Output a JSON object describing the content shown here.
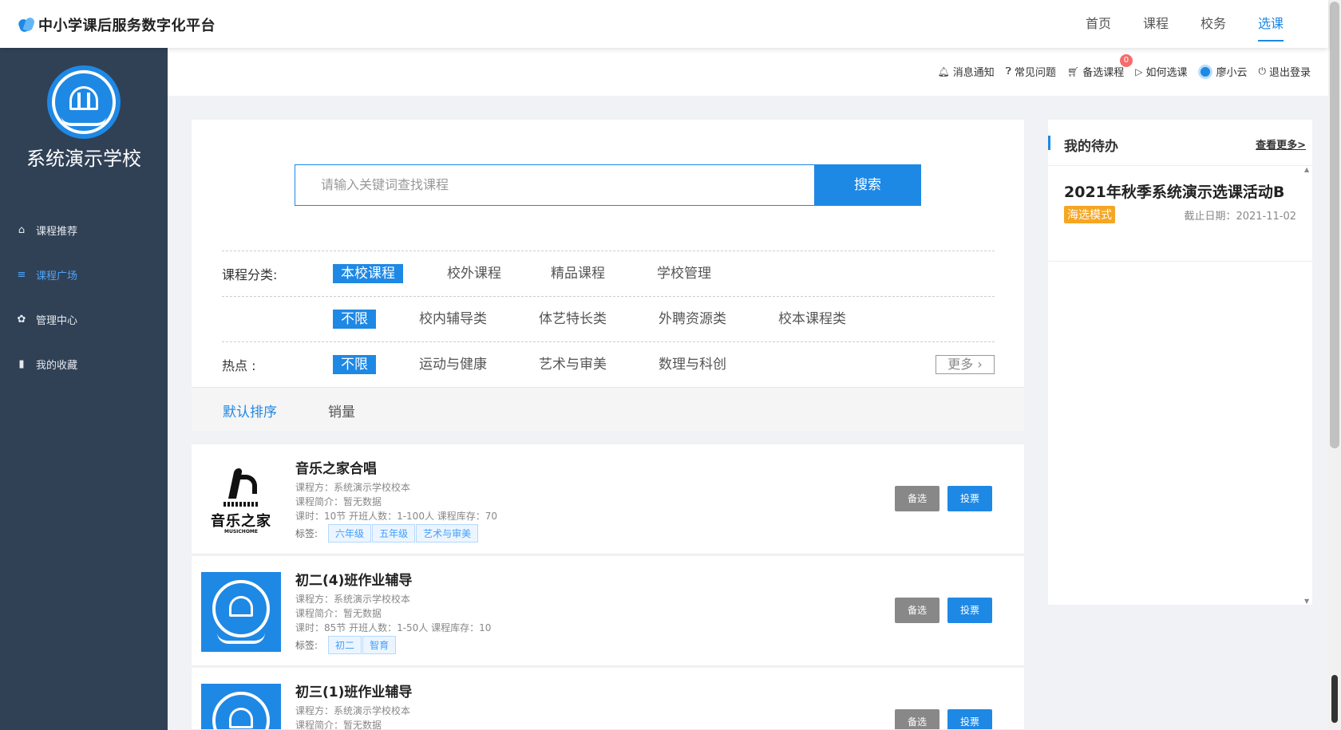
{
  "header": {
    "title": "中小学课后服务数字化平台",
    "nav": [
      "首页",
      "课程",
      "校务",
      "选课"
    ],
    "active_nav": "选课"
  },
  "sidebar": {
    "school_name": "系统演示学校",
    "items": [
      {
        "label": "课程推荐",
        "icon": "home-icon"
      },
      {
        "label": "课程广场",
        "icon": "list-icon"
      },
      {
        "label": "管理中心",
        "icon": "gear-icon"
      },
      {
        "label": "我的收藏",
        "icon": "bookmark-icon"
      }
    ],
    "active_item": "课程广场"
  },
  "toolbar": {
    "notice": "消息通知",
    "faq": "常见问题",
    "cart": "备选课程",
    "cart_count": "0",
    "howto": "如何选课",
    "user": "廖小云",
    "logout": "退出登录"
  },
  "search": {
    "placeholder": "请输入关键词查找课程",
    "button": "搜索"
  },
  "filters": {
    "category_label": "课程分类:",
    "categories": [
      "本校课程",
      "校外课程",
      "精品课程",
      "学校管理"
    ],
    "sub_categories": [
      "不限",
      "校内辅导类",
      "体艺特长类",
      "外聘资源类",
      "校本课程类"
    ],
    "hot_label": "热点 :",
    "hot": [
      "不限",
      "运动与健康",
      "艺术与审美",
      "数理与科创"
    ],
    "more": "更多"
  },
  "sort": {
    "options": [
      "默认排序",
      "销量"
    ]
  },
  "courses": [
    {
      "title": "音乐之家合唱",
      "provider": "课程方：系统演示学校校本",
      "intro": "课程简介：暂无数据",
      "meta": "课时：10节   开班人数：1-100人   课程库存：70",
      "tag_label": "标签:",
      "tags": [
        "六年级",
        "五年级",
        "艺术与审美"
      ],
      "thumb_text": "音乐之家",
      "thumb_sub": "MUSICHOME",
      "btn_select": "备选",
      "btn_vote": "投票"
    },
    {
      "title": "初二(4)班作业辅导",
      "provider": "课程方：系统演示学校校本",
      "intro": "课程简介：暂无数据",
      "meta": "课时：85节   开班人数：1-50人   课程库存：10",
      "tag_label": "标签:",
      "tags": [
        "初二",
        "智育"
      ],
      "btn_select": "备选",
      "btn_vote": "投票"
    },
    {
      "title": "初三(1)班作业辅导",
      "provider": "课程方：系统演示学校校本",
      "intro": "课程简介：暂无数据",
      "btn_select": "备选",
      "btn_vote": "投票"
    }
  ],
  "todo": {
    "title": "我的待办",
    "more": "查看更多>",
    "items": [
      {
        "title": "2021年秋季系统演示选课活动B",
        "mode": "海选模式",
        "deadline": "截止日期：2021-11-02"
      }
    ]
  },
  "colors": {
    "primary": "#1e88e5",
    "sidebar_bg": "#304156",
    "mode_badge": "#f5a623"
  }
}
